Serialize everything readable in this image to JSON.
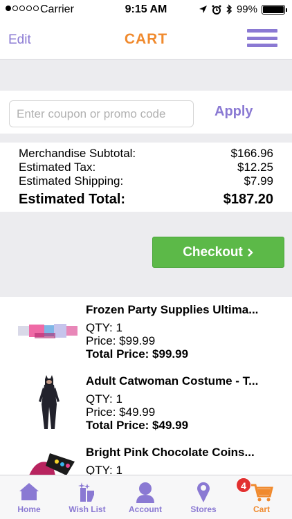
{
  "status_bar": {
    "carrier": "Carrier",
    "time": "9:15 AM",
    "battery": "99%"
  },
  "nav": {
    "edit_label": "Edit",
    "title": "CART"
  },
  "coupon": {
    "placeholder": "Enter coupon or promo code",
    "value": "",
    "apply_label": "Apply"
  },
  "totals": {
    "subtotal_label": "Merchandise Subtotal:",
    "subtotal_value": "$166.96",
    "tax_label": "Estimated Tax:",
    "tax_value": "$12.25",
    "shipping_label": "Estimated Shipping:",
    "shipping_value": "$7.99",
    "total_label": "Estimated Total:",
    "total_value": "$187.20"
  },
  "checkout_label": "Checkout",
  "items": [
    {
      "name": "Frozen Party Supplies Ultima...",
      "qty": "QTY: 1",
      "price": "Price: $99.99",
      "total": "Total Price: $99.99"
    },
    {
      "name": "Adult Catwoman Costume - T...",
      "qty": "QTY: 1",
      "price": "Price: $49.99",
      "total": "Total Price: $49.99"
    },
    {
      "name": "Bright Pink Chocolate Coins...",
      "qty": "QTY: 1",
      "price": "",
      "total": ""
    }
  ],
  "tabs": [
    {
      "label": "Home",
      "icon": "home-icon"
    },
    {
      "label": "Wish List",
      "icon": "wish-list-icon"
    },
    {
      "label": "Account",
      "icon": "account-icon"
    },
    {
      "label": "Stores",
      "icon": "stores-icon"
    },
    {
      "label": "Cart",
      "icon": "cart-icon"
    }
  ],
  "cart_badge": "4",
  "colors": {
    "accent": "#8a79d3",
    "brand_orange": "#f08a2e",
    "checkout_green": "#5cb948",
    "badge_red": "#e23030"
  }
}
